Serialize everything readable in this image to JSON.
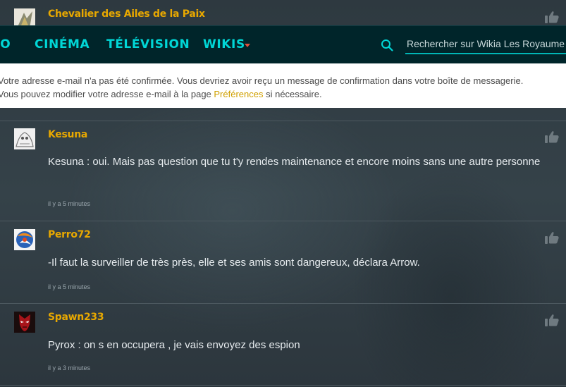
{
  "top_comment": {
    "username": "Chevalier des Ailes de la Paix"
  },
  "nav": {
    "items": [
      {
        "label": "ÉO"
      },
      {
        "label": "CINÉMA"
      },
      {
        "label": "TÉLÉVISION"
      },
      {
        "label": "WIKIS"
      }
    ],
    "search_placeholder": "Rechercher sur Wikia Les Royaume"
  },
  "notice": {
    "line1": "Votre adresse e-mail n'a pas été confirmée. Vous devriez avoir reçu un message de confirmation dans votre boîte de messagerie.",
    "line2_prefix": "Vous pouvez modifier votre adresse e-mail à la page ",
    "line2_link": "Préférences",
    "line2_suffix": " si nécessaire."
  },
  "comments": [
    {
      "username": "Kesuna",
      "text": "Kesuna : oui. Mais pas question que tu t'y  rendes maintenance et encore moins sans une autre personne",
      "time": "il y a 5 minutes"
    },
    {
      "username": "Perro72",
      "text": "-Il faut la surveiller de très près, elle et ses amis sont dangereux, déclara Arrow.",
      "time": "il y a 5 minutes"
    },
    {
      "username": "Spawn233",
      "text": "Pyrox : on s en occupera , je vais envoyez des espion",
      "time": "il y a 3 minutes"
    }
  ],
  "colors": {
    "accent": "#00d6d6",
    "username": "#e8a800",
    "navbar_bg": "#00252a",
    "link": "#d0a000"
  }
}
